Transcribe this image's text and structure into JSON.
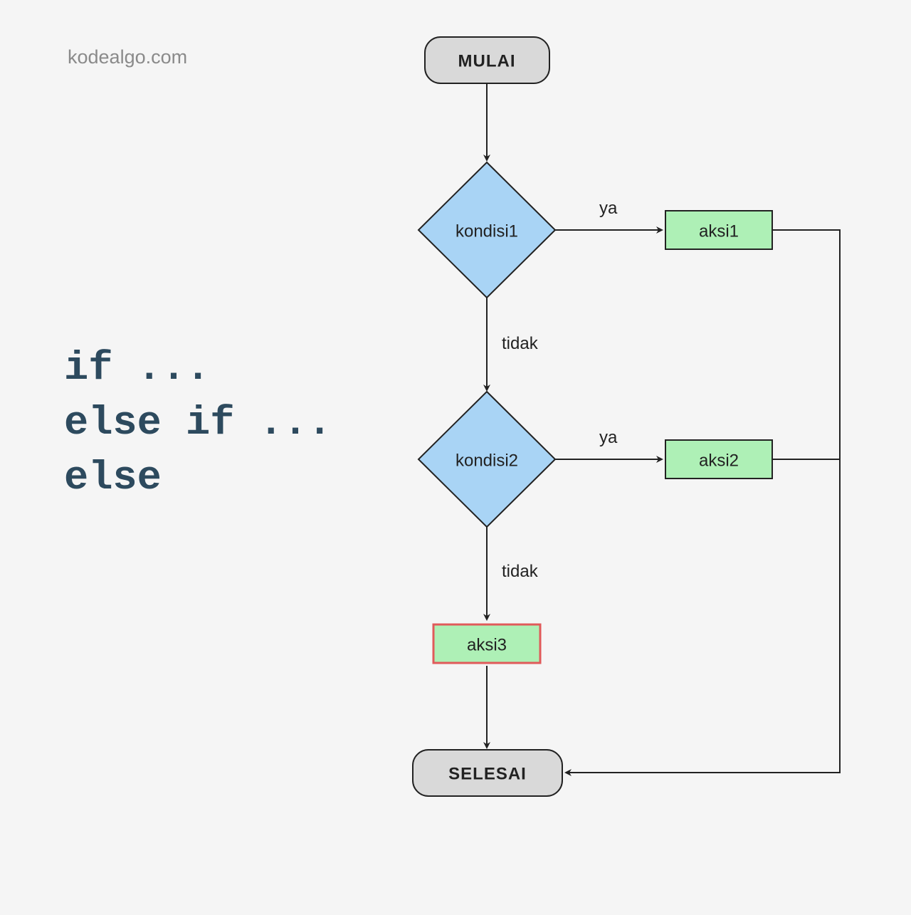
{
  "watermark": "kodealgo.com",
  "headline": {
    "line1": "if ...",
    "line2": "else if ...",
    "line3": "else"
  },
  "flowchart": {
    "start": "MULAI",
    "end": "SELESAI",
    "decision1": "kondisi1",
    "decision2": "kondisi2",
    "action1": "aksi1",
    "action2": "aksi2",
    "action3": "aksi3",
    "yes": "ya",
    "no": "tidak"
  },
  "colors": {
    "terminator_fill": "#d9d9d9",
    "decision_fill": "#a9d4f5",
    "action_fill": "#aef0b6",
    "stroke": "#222222",
    "action3_stroke": "#e05a5a",
    "headline": "#2d4a5e"
  }
}
